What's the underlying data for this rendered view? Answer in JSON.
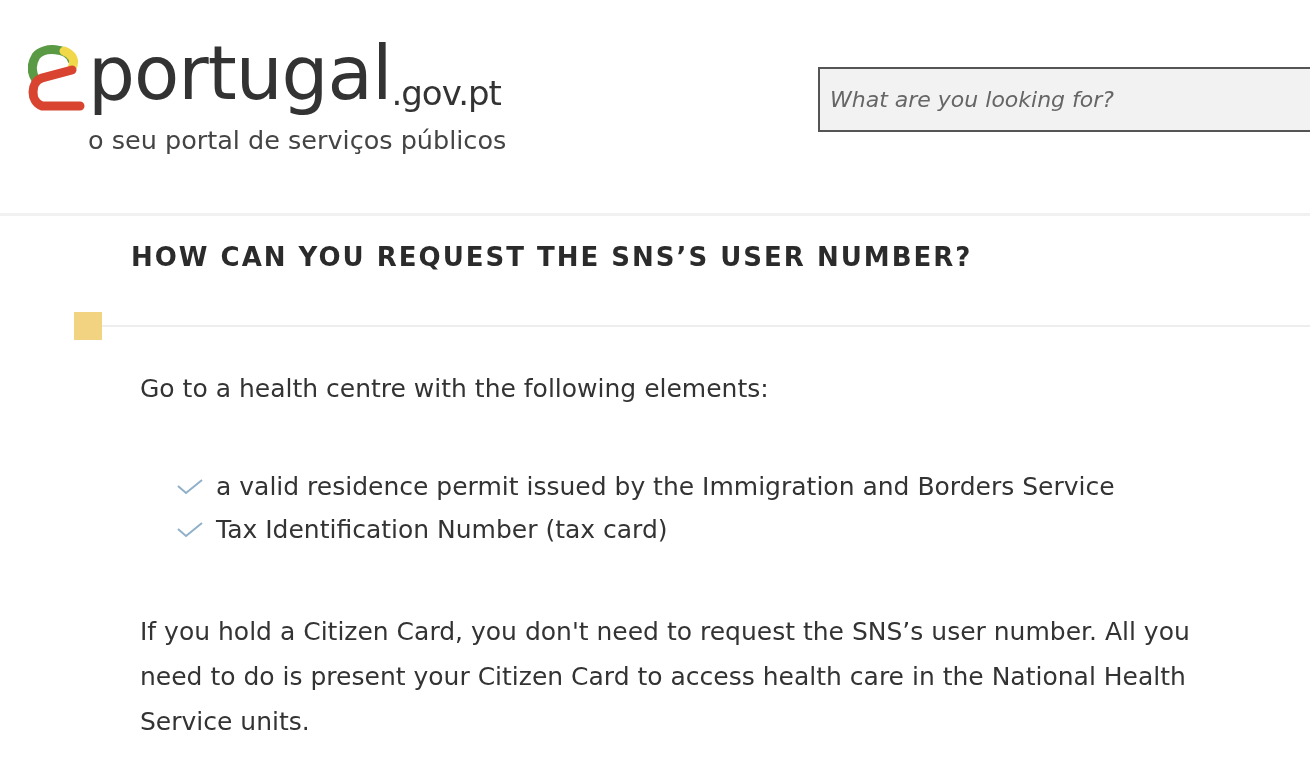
{
  "header": {
    "logo": {
      "name": "portugal",
      "domain": ".gov.pt",
      "tagline": "o seu portal de serviços públicos"
    },
    "search": {
      "placeholder": "What are you looking for?"
    }
  },
  "article": {
    "title": "HOW CAN YOU REQUEST THE SNS’S USER NUMBER?",
    "intro": "Go to a health centre with the following elements:",
    "requirements": [
      "a valid residence permit issued by the Immigration and Borders Service",
      "Tax Identification Number (tax card)"
    ],
    "note": "If you hold a Citizen Card, you don't need to request the SNS’s user number. All you need to do is present your Citizen Card to access health care in the National Health Service units."
  }
}
